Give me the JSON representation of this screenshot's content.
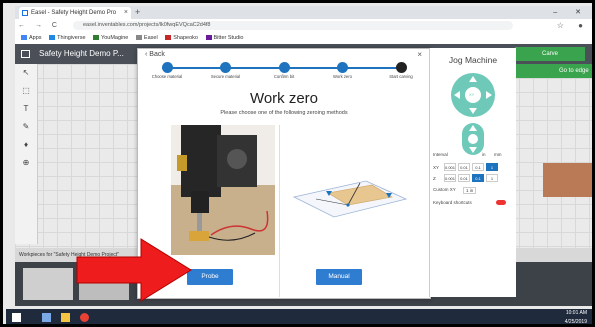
{
  "browser": {
    "tab_title": "Easel - Safety Height Demo Pro",
    "tab_close": "×",
    "new_tab": "+",
    "window_controls": "–  ✕",
    "nav_buttons": "← → C",
    "url": "easel.inventables.com/projects/lk0fwqEVQcaC2d4f8",
    "address_right": "☆ ●",
    "bookmarks": [
      "Apps",
      "Thingiverse",
      "YouMagine",
      "Easel",
      "Shapeoko",
      "Bitter Studio"
    ]
  },
  "app": {
    "title": "Safety Height Demo P...",
    "carve_button": "Carve",
    "zoom_label": "Go to edge",
    "bottom_bar_text": "Workpieces for \"Safety Height Demo Project\"",
    "left_tools": [
      "↖",
      "⬚",
      "T",
      "✎",
      "♦",
      "⊕"
    ]
  },
  "modal": {
    "back_label": "‹ Back",
    "close_label": "×",
    "steps": [
      "Choose material",
      "Secure material",
      "Confirm bit",
      "Work zero",
      "Start carving"
    ],
    "active_step": 3,
    "title": "Work zero",
    "subtitle": "Please choose one of the following zeroing methods",
    "probe_button": "Probe",
    "manual_button": "Manual"
  },
  "jog": {
    "title": "Jog Machine",
    "center_label": "XY",
    "interval_label": "Interval",
    "units": [
      "in",
      "mm"
    ],
    "xy_label": "XY",
    "z_label": "Z",
    "xy_values": [
      "0.001",
      "0.01",
      "0.1",
      "1"
    ],
    "z_values": [
      "0.001",
      "0.01",
      "0.1",
      "1"
    ],
    "xy_selected": 3,
    "z_selected": 2,
    "custom_label": "Custom XY",
    "custom_value": "1 in",
    "keyboard_label": "Keyboard shortcuts"
  },
  "taskbar": {
    "time": "10:01 AM",
    "date": "4/25/2019"
  },
  "colors": {
    "accent": "#1e73be",
    "button_blue": "#2f7dd1",
    "carve_green": "#3aa34d",
    "jog_teal": "#6fc9b8",
    "arrow_red": "#ee1c1c"
  }
}
